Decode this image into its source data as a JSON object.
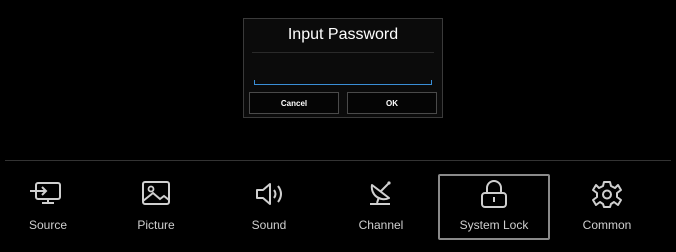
{
  "dialog": {
    "title": "Input Password",
    "input_value": "",
    "cancel_label": "Cancel",
    "ok_label": "OK"
  },
  "menu": {
    "items": [
      {
        "label": "Source",
        "icon": "source-icon"
      },
      {
        "label": "Picture",
        "icon": "picture-icon"
      },
      {
        "label": "Sound",
        "icon": "sound-icon"
      },
      {
        "label": "Channel",
        "icon": "channel-icon"
      },
      {
        "label": "System Lock",
        "icon": "lock-icon",
        "selected": true
      },
      {
        "label": "Common",
        "icon": "gear-icon"
      }
    ]
  },
  "colors": {
    "background": "#000000",
    "input_underline": "#3a8ed6",
    "selection_border": "#8a8a8a"
  }
}
